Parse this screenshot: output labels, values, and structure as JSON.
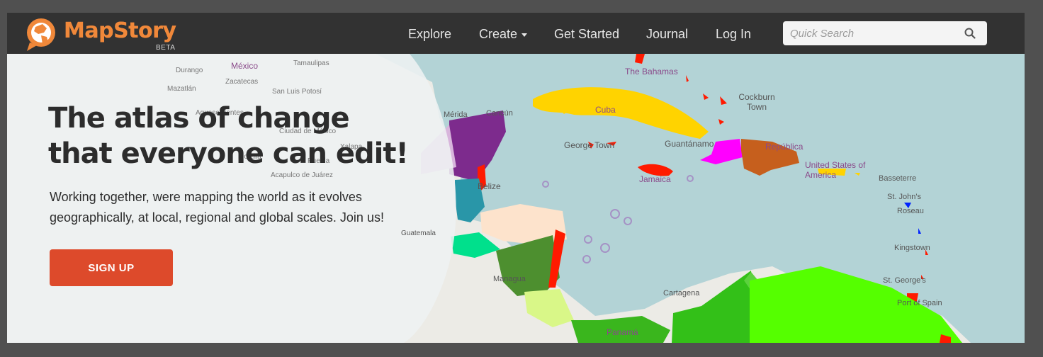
{
  "brand": {
    "name": "MapStory",
    "badge": "BETA",
    "color": "#f0883a"
  },
  "nav": {
    "items": [
      {
        "label": "Explore"
      },
      {
        "label": "Create",
        "has_dropdown": true
      },
      {
        "label": "Get Started"
      },
      {
        "label": "Journal"
      },
      {
        "label": "Log In"
      }
    ]
  },
  "search": {
    "placeholder": "Quick Search",
    "value": "",
    "icon": "search-icon"
  },
  "hero": {
    "title": "The atlas of change that everyone can edit!",
    "subtitle": "Working together, were mapping the world as it evolves geographically, at local, regional and global scales. Join us!",
    "cta_label": "SIGN UP",
    "cta_color": "#dd4a2b"
  },
  "map": {
    "labels": {
      "durango": "Durango",
      "mexico": "México",
      "tamaulipas": "Tamaulipas",
      "mazatlan": "Mazatlán",
      "zacatecas": "Zacatecas",
      "san_luis_potosi": "San Luis Potosí",
      "aguascalientes": "Aguascalientes",
      "ciudad_de_mexico": "Ciudad de México",
      "xalapa": "Xalapa",
      "morelia": "Morelia",
      "puebla": "Puebla",
      "acapulco": "Acapulco de Juárez",
      "merida": "Mérida",
      "cancun": "Cancún",
      "belize": "Belize",
      "cuba": "Cuba",
      "bahamas": "The Bahamas",
      "cockburn": "Cockburn Town",
      "george_town": "George Town",
      "guantanamo": "Guantánamo",
      "jamaica": "Jamaica",
      "republica": "República",
      "us": "United States of America",
      "basseterre": "Basseterre",
      "st_johns": "St. John's",
      "roseau": "Roseau",
      "kingstown": "Kingstown",
      "st_georges": "St. George's",
      "port_of_spain": "Port of Spain",
      "cartagena": "Cartagena",
      "panama": "Panamá",
      "managua": "Managua",
      "guatemala": "Guatemala"
    }
  }
}
